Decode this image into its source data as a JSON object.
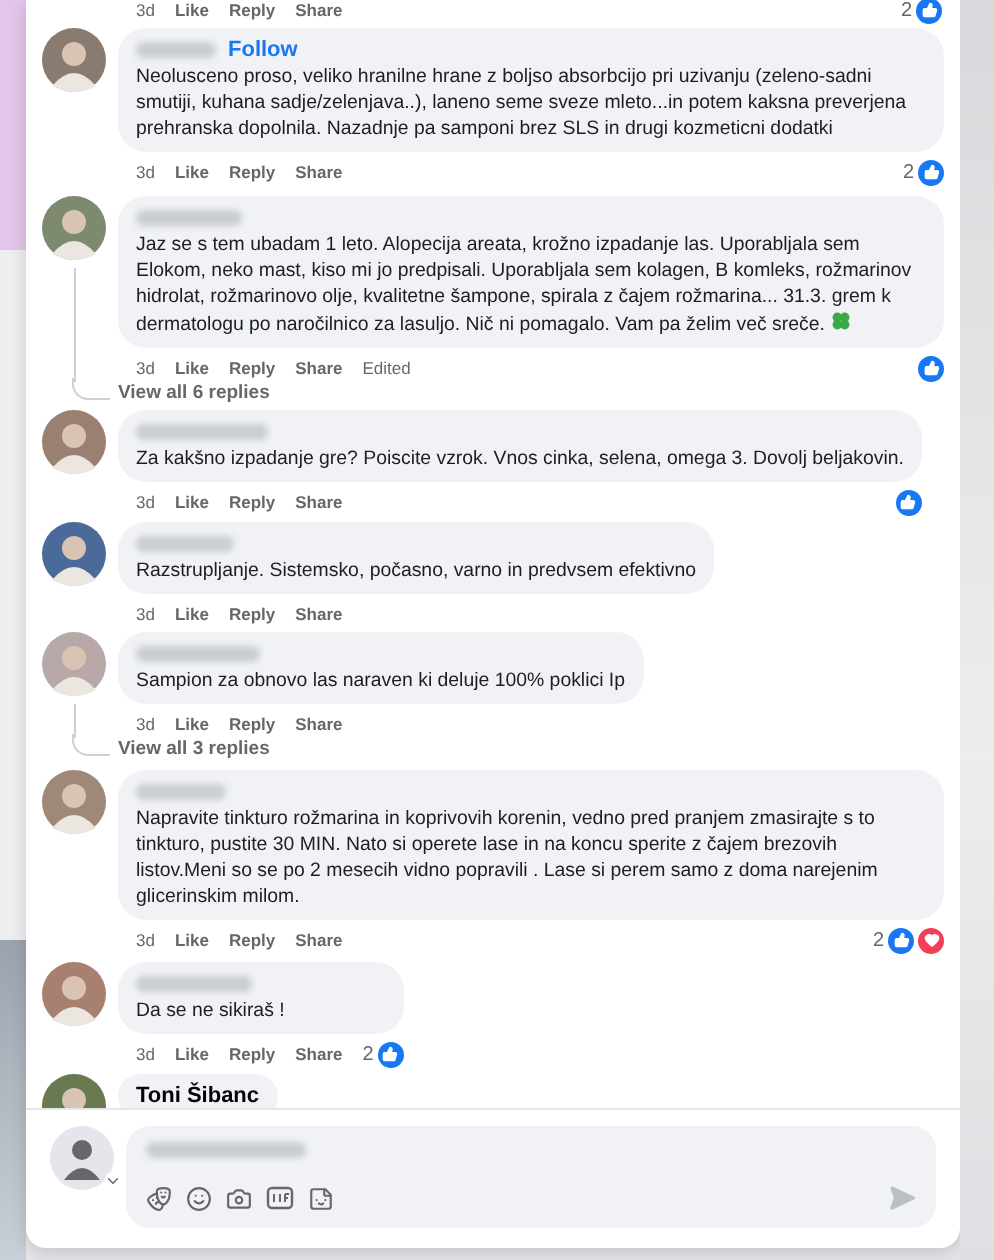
{
  "top_meta": {
    "time": "3d",
    "actions": [
      "Like",
      "Reply",
      "Share"
    ],
    "reaction_count": "2",
    "like": true
  },
  "comments": [
    {
      "author": {
        "blurred": true
      },
      "follow": "Follow",
      "text": "Neolusceno proso, veliko hranilne hrane z boljso absorbcijo pri uzivanju (zeleno-sadni smutiji, kuhana sadje/zelenjava..), laneno seme sveze mleto...in potem kaksna preverjena prehranska dopolnila. Nazadnje pa samponi brez SLS in drugi kozmeticni dodatki",
      "time": "3d",
      "actions": [
        "Like",
        "Reply",
        "Share"
      ],
      "reaction_count": "2",
      "like": true
    },
    {
      "author": {
        "blurred": true
      },
      "text": "Jaz se s tem ubadam 1 leto. Alopecija areata, krožno izpadanje las. Uporabljala sem Elokom, neko mast, kiso mi jo predpisali. Uporabljala sem kolagen, B komleks, rožmarinov hidrolat, rožmarinovo olje, kvalitetne šampone, spirala z čajem rožmarina... 31.3. grem k dermatologu po naročilnico za lasuljo. Nič ni pomagalo. Vam pa želim več sreče.",
      "emoji": true,
      "time": "3d",
      "actions": [
        "Like",
        "Reply",
        "Share"
      ],
      "edited": "Edited",
      "like": true,
      "replies": "View all 6 replies"
    },
    {
      "author": {
        "blurred": true
      },
      "text": "Za kakšno izpadanje gre? Poiscite vzrok. Vnos cinka, selena, omega 3. Dovolj beljakovin.",
      "time": "3d",
      "actions": [
        "Like",
        "Reply",
        "Share"
      ],
      "like": true
    },
    {
      "author": {
        "blurred": true
      },
      "text": "Razstrupljanje. Sistemsko, počasno, varno in predvsem efektivno",
      "time": "3d",
      "actions": [
        "Like",
        "Reply",
        "Share"
      ]
    },
    {
      "author": {
        "blurred": true
      },
      "text": "Sampion za obnovo las naraven ki deluje 100% poklici Ip",
      "time": "3d",
      "actions": [
        "Like",
        "Reply",
        "Share"
      ],
      "replies": "View all 3 replies"
    },
    {
      "author": {
        "blurred": true
      },
      "text": "Napravite tinkturo rožmarina in koprivovih korenin, vedno pred pranjem zmasirajte s to tinkturo, pustite 30 MIN. Nato si operete lase in na koncu sperite z čajem brezovih listov.Meni so se po 2 mesecih vidno popravili . Lase si perem samo z doma narejenim glicerinskim milom.",
      "time": "3d",
      "actions": [
        "Like",
        "Reply",
        "Share"
      ],
      "reaction_count": "2",
      "like": true,
      "love": true
    },
    {
      "author": {
        "blurred": true
      },
      "text": "Da se ne sikiraš !",
      "time": "3d",
      "actions": [
        "Like",
        "Reply",
        "Share"
      ],
      "reaction_count": "2",
      "like": true
    },
    {
      "author": {
        "name": "Toni Šibanc"
      }
    }
  ],
  "composer": {
    "placeholder_blurred": true
  }
}
